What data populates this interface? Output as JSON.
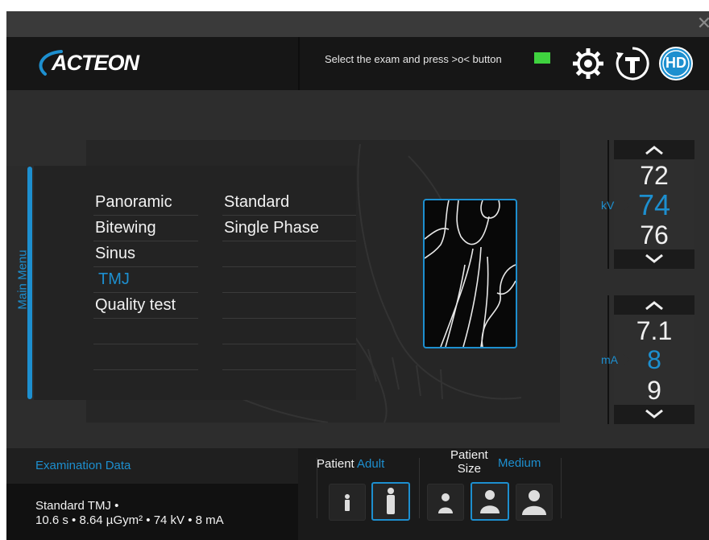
{
  "window": {
    "close_glyph": "✕"
  },
  "header": {
    "logo_text": "ACTEON",
    "instruction": "Select the exam and press >o< button",
    "status_led_color": "#3fd23f",
    "icons": [
      "gear-icon",
      "timer-t-icon",
      "hd-icon"
    ],
    "hd_label": "HD"
  },
  "main_menu": {
    "label": "Main Menu"
  },
  "exam_types": [
    {
      "label": "Panoramic",
      "selected": false
    },
    {
      "label": "Bitewing",
      "selected": false
    },
    {
      "label": "Sinus",
      "selected": false
    },
    {
      "label": "TMJ",
      "selected": true
    },
    {
      "label": "Quality test",
      "selected": false
    }
  ],
  "exam_modes": [
    {
      "label": "Standard"
    },
    {
      "label": "Single Phase"
    }
  ],
  "kv": {
    "unit": "kV",
    "prev": "72",
    "current": "74",
    "next": "76"
  },
  "ma": {
    "unit": "mA",
    "prev": "7.1",
    "current": "8",
    "next": "9"
  },
  "examination_data": {
    "title": "Examination Data",
    "line1": "Standard TMJ •",
    "line2": "10.6 s • 8.64 µGym² • 74 kV • 8 mA"
  },
  "patient": {
    "label": "Patient",
    "value": "Adult"
  },
  "patient_size": {
    "label_line1": "Patient",
    "label_line2": "Size",
    "value": "Medium"
  },
  "colors": {
    "accent": "#1d8fcf",
    "background": "#2d2d2d"
  }
}
